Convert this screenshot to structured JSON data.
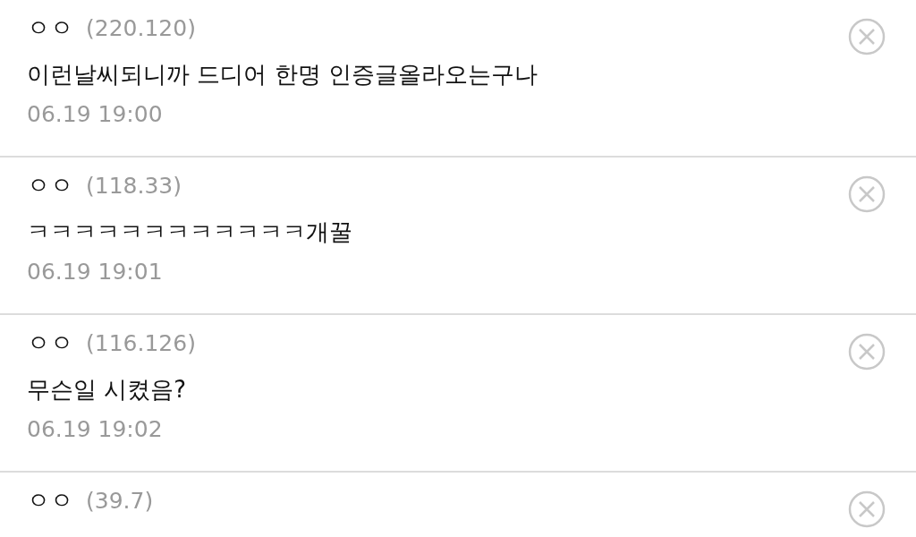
{
  "comments": [
    {
      "author": "ㅇㅇ",
      "ip": "(220.120)",
      "text": "이런날씨되니까 드디어 한명 인증글올라오는구나",
      "date": "06.19 19:00"
    },
    {
      "author": "ㅇㅇ",
      "ip": "(118.33)",
      "text": "ㅋㅋㅋㅋㅋㅋㅋㅋㅋㅋㅋㅋ개꿀",
      "date": "06.19 19:01"
    },
    {
      "author": "ㅇㅇ",
      "ip": "(116.126)",
      "text": "무슨일 시켰음?",
      "date": "06.19 19:02"
    },
    {
      "author": "ㅇㅇ",
      "ip": "(39.7)"
    }
  ]
}
